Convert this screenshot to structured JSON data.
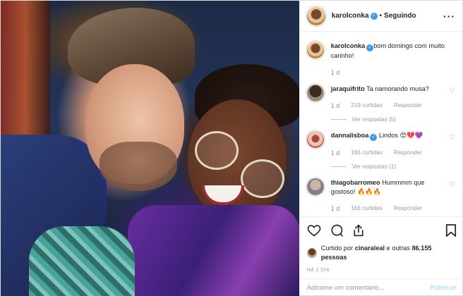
{
  "post": {
    "author": "karolconka",
    "follow_status": "Seguindo",
    "more_icon": "more-horizontal-icon"
  },
  "caption": {
    "author": "karolconka",
    "text": "bom domingo com muito carinho!",
    "age": "1 d"
  },
  "comments": [
    {
      "author": "jaraquifrito",
      "text": "Ta namorando musa?",
      "age": "1 d",
      "likes": "219 curtidas",
      "reply": "Responder",
      "view_replies": "Ver respostas (5)"
    },
    {
      "author": "dannalisboa",
      "text": "Lindos 😍💔💜",
      "age": "1 d",
      "likes": "186 curtidas",
      "reply": "Responder",
      "view_replies": "Ver respostas (1)"
    },
    {
      "author": "thiagobarromeo",
      "text": "Hummmm que gostoso! 🔥🔥🔥",
      "age": "1 d",
      "likes": "166 curtidas",
      "reply": "Responder"
    }
  ],
  "likes_summary": {
    "prefix": "Curtido por ",
    "user": "cinaraleal",
    "middle": " e outras ",
    "count": "86.155 pessoas"
  },
  "post_date": "HÁ 1 DIA",
  "comment_box": {
    "placeholder": "Adicione um comentário...",
    "publish": "Publicar"
  },
  "colors": {
    "verified": "#3897f0",
    "publish_disabled": "#b2dffc",
    "muted": "#999999"
  }
}
